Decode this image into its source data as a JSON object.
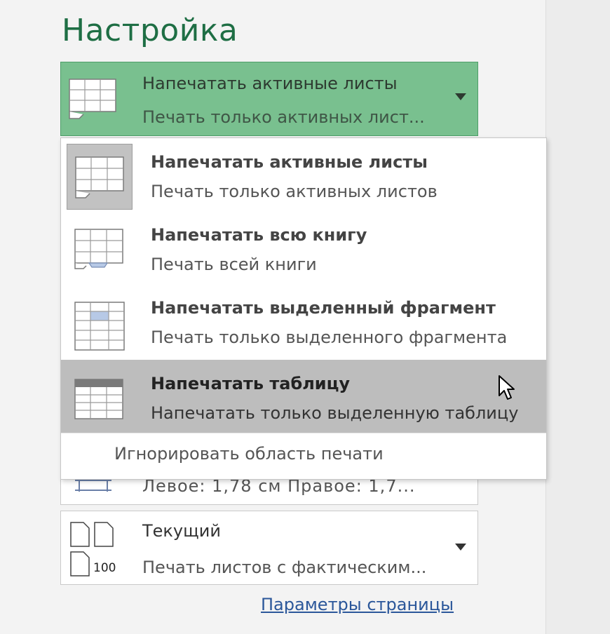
{
  "section_title": "Настройка",
  "print_what": {
    "selected_title": "Напечатать активные листы",
    "selected_sub": "Печать только активных лист...",
    "icon": "active-sheets-icon"
  },
  "dropdown": {
    "items": [
      {
        "title": "Напечатать активные листы",
        "sub": "Печать только активных листов",
        "icon": "active-sheets-icon"
      },
      {
        "title": "Напечатать всю книгу",
        "sub": "Печать всей книги",
        "icon": "whole-workbook-icon"
      },
      {
        "title": "Напечатать выделенный фрагмент",
        "sub": "Печать только выделенного фрагмента",
        "icon": "selection-icon"
      },
      {
        "title": "Напечатать таблицу",
        "sub": "Напечатать только выделенную таблицу",
        "icon": "table-icon"
      }
    ],
    "ignore_label": "Игнорировать область печати"
  },
  "margins": {
    "text": "Левое:  1,78 см    Правое:  1,7...",
    "icon": "margins-icon"
  },
  "scaling": {
    "title": "Текущий",
    "sub": "Печать листов с фактическим...",
    "icon": "scaling-100-icon",
    "icon_label": "100"
  },
  "page_setup_link": "Параметры страницы",
  "colors": {
    "title_green": "#1e6e44",
    "selected_bg": "#79c08f",
    "hover_bg": "#bdbdbd",
    "link": "#2b579a"
  }
}
